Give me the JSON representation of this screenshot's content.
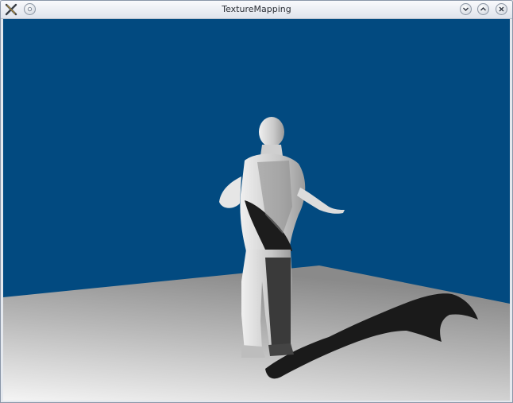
{
  "window": {
    "title": "TextureMapping",
    "icons": {
      "app": "app-x-icon",
      "menu": "window-menu-icon",
      "minimize": "chevron-down-icon",
      "maximize": "chevron-up-icon",
      "close": "close-icon"
    }
  },
  "scene": {
    "wall_color": "#024a80",
    "floor_near_color": "#f4f4f4",
    "floor_far_color": "#8a8a8a",
    "figure_color": "#d8d8d8",
    "shadow_color": "#1a1a1a"
  }
}
